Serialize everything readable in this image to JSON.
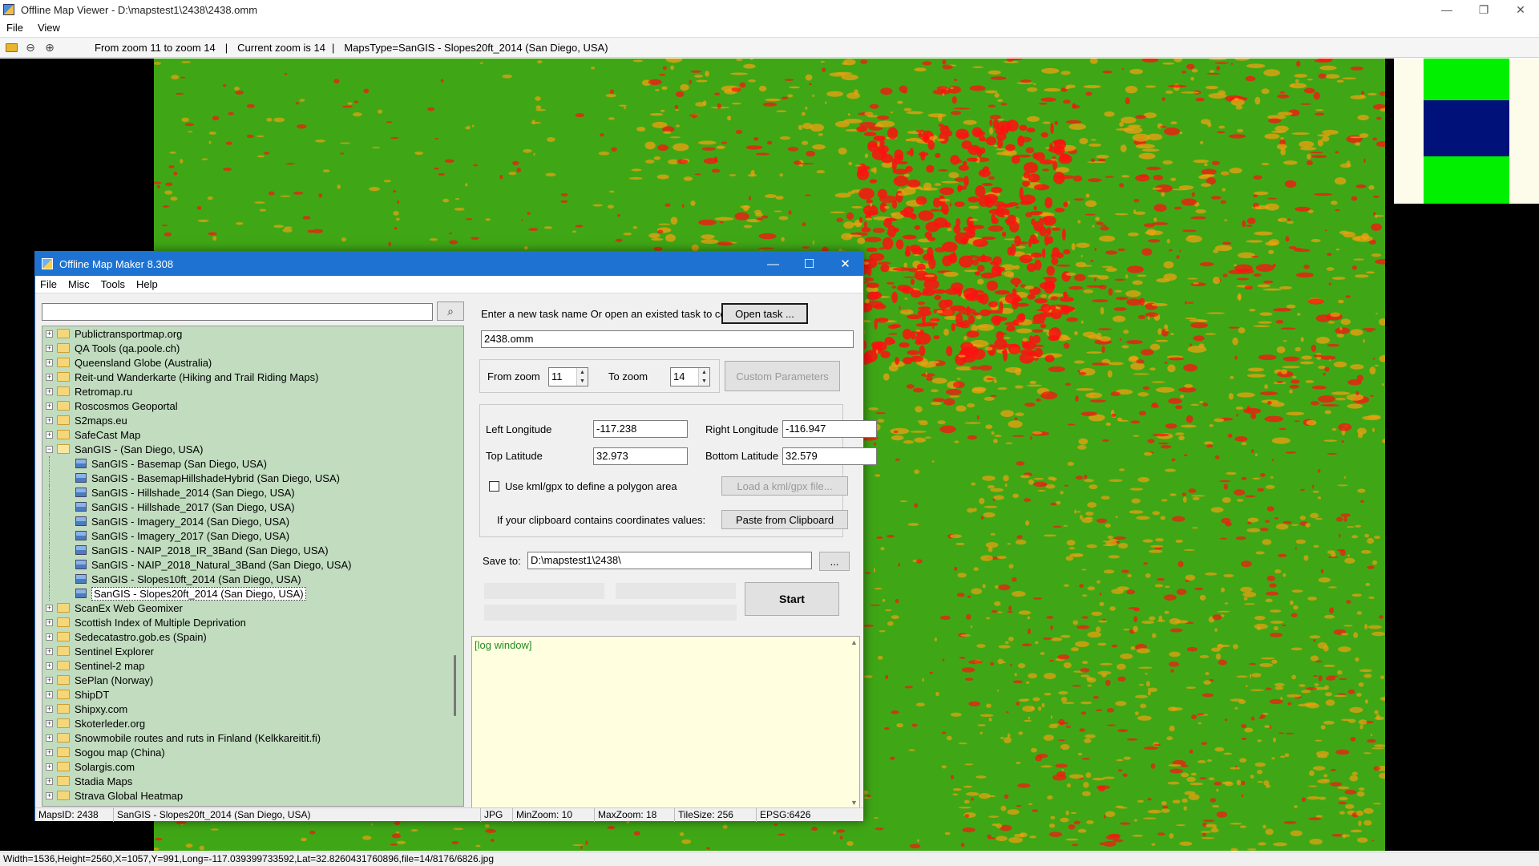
{
  "viewer": {
    "title": "Offline Map Viewer - D:\\mapstest1\\2438\\2438.omm",
    "menu": [
      "File",
      "View"
    ],
    "toolbar": {
      "zoom_range": "From zoom 11 to zoom 14",
      "current_zoom": "Current zoom is 14",
      "maps_type": "MapsType=SanGIS - Slopes20ft_2014 (San Diego, USA)",
      "separator": "|"
    },
    "status": "Width=1536,Height=2560,X=1057,Y=991,Long=-117.039399733592,Lat=32.8260431760896,file=14/8176/6826.jpg",
    "window_controls": {
      "minimize": "—",
      "restore": "❐",
      "close": "✕"
    }
  },
  "map": {
    "colors": {
      "low": "#3fa716",
      "mid": "#f0a010",
      "high": "#ff1010"
    },
    "minimap_colors": {
      "cream": "#fdfbea",
      "green": "#00f000",
      "navy": "#00127a"
    }
  },
  "dialog": {
    "title": "Offline Map Maker 8.308",
    "menu": [
      "File",
      "Misc",
      "Tools",
      "Help"
    ],
    "window_controls": {
      "minimize": "—",
      "maximize": "☐",
      "close": "✕"
    },
    "search": {
      "value": "",
      "icon": "search-icon"
    },
    "tree": [
      {
        "label": "Publictransportmap.org",
        "type": "folder"
      },
      {
        "label": "QA Tools (qa.poole.ch)",
        "type": "folder"
      },
      {
        "label": "Queensland Globe (Australia)",
        "type": "folder"
      },
      {
        "label": "Reit-und Wanderkarte (Hiking and Trail Riding Maps)",
        "type": "folder"
      },
      {
        "label": "Retromap.ru",
        "type": "folder"
      },
      {
        "label": "Roscosmos Geoportal",
        "type": "folder"
      },
      {
        "label": "S2maps.eu",
        "type": "folder"
      },
      {
        "label": "SafeCast Map",
        "type": "folder"
      },
      {
        "label": "SanGIS - (San Diego, USA)",
        "type": "folder-open"
      },
      {
        "label": "SanGIS - Basemap (San Diego, USA)",
        "type": "map"
      },
      {
        "label": "SanGIS - BasemapHillshadeHybrid (San Diego, USA)",
        "type": "map"
      },
      {
        "label": "SanGIS - Hillshade_2014 (San Diego, USA)",
        "type": "map"
      },
      {
        "label": "SanGIS - Hillshade_2017 (San Diego, USA)",
        "type": "map"
      },
      {
        "label": "SanGIS - Imagery_2014 (San Diego, USA)",
        "type": "map"
      },
      {
        "label": "SanGIS - Imagery_2017 (San Diego, USA)",
        "type": "map"
      },
      {
        "label": "SanGIS - NAIP_2018_IR_3Band (San Diego, USA)",
        "type": "map"
      },
      {
        "label": "SanGIS - NAIP_2018_Natural_3Band (San Diego, USA)",
        "type": "map"
      },
      {
        "label": "SanGIS - Slopes10ft_2014 (San Diego, USA)",
        "type": "map"
      },
      {
        "label": "SanGIS - Slopes20ft_2014 (San Diego, USA)",
        "type": "map",
        "selected": true
      },
      {
        "label": "ScanEx Web Geomixer",
        "type": "folder"
      },
      {
        "label": "Scottish Index of Multiple Deprivation",
        "type": "folder"
      },
      {
        "label": "Sedecatastro.gob.es (Spain)",
        "type": "folder"
      },
      {
        "label": "Sentinel Explorer",
        "type": "folder"
      },
      {
        "label": "Sentinel-2 map",
        "type": "folder"
      },
      {
        "label": "SePlan (Norway)",
        "type": "folder"
      },
      {
        "label": "ShipDT",
        "type": "folder"
      },
      {
        "label": "Shipxy.com",
        "type": "folder"
      },
      {
        "label": "Skoterleder.org",
        "type": "folder"
      },
      {
        "label": "Snowmobile routes and ruts in Finland (Kelkkareitit.fi)",
        "type": "folder"
      },
      {
        "label": "Sogou map (China)",
        "type": "folder"
      },
      {
        "label": "Solargis.com",
        "type": "folder"
      },
      {
        "label": "Stadia Maps",
        "type": "folder"
      },
      {
        "label": "Strava Global Heatmap",
        "type": "folder"
      }
    ],
    "task": {
      "prompt": "Enter a new task name Or open an existed task to continue:",
      "open_button": "Open task ...",
      "task_name": "2438.omm"
    },
    "zoom": {
      "from_label": "From zoom",
      "from_value": "11",
      "to_label": "To zoom",
      "to_value": "14",
      "custom_button": "Custom Parameters"
    },
    "bounds": {
      "left_label": "Left Longitude",
      "left_value": "-117.238",
      "right_label": "Right Longitude",
      "right_value": "-116.947",
      "top_label": "Top Latitude",
      "top_value": "32.973",
      "bottom_label": "Bottom Latitude",
      "bottom_value": "32.579",
      "kml_checkbox_label": "Use kml/gpx to define a polygon area",
      "kml_checked": false,
      "load_kml_button": "Load a kml/gpx file...",
      "clipboard_label": "If your clipboard contains coordinates values:",
      "paste_button": "Paste from Clipboard"
    },
    "save": {
      "label": "Save to:",
      "path": "D:\\mapstest1\\2438\\",
      "browse_button": "..."
    },
    "start_button": "Start",
    "log_text": "[log window]",
    "status": {
      "maps_id": "MapsID: 2438",
      "map_name": "SanGIS - Slopes20ft_2014 (San Diego, USA)",
      "format": "JPG",
      "min_zoom": "MinZoom: 10",
      "max_zoom": "MaxZoom: 18",
      "tile_size": "TileSize: 256",
      "epsg": "EPSG:6426"
    }
  }
}
